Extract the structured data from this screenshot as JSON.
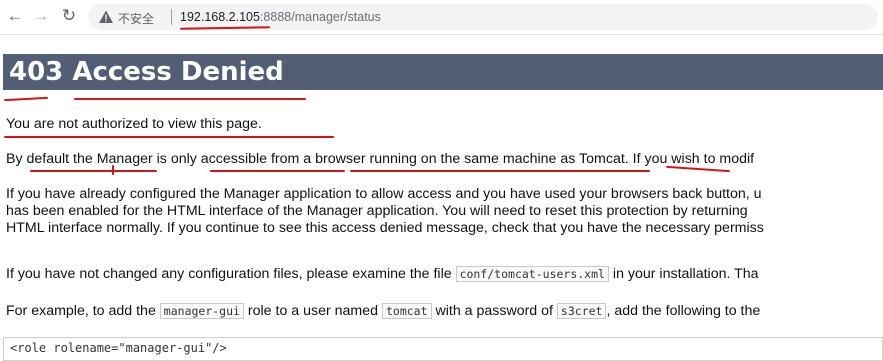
{
  "browser": {
    "security_label": "不安全",
    "url_host": "192.168.2.105",
    "url_rest": ":8888/manager/status"
  },
  "page": {
    "heading": "403 Access Denied",
    "p1": "You are not authorized to view this page.",
    "p2": "By default the Manager is only accessible from a browser running on the same machine as Tomcat. If you wish to modif",
    "p3_line1": "If you have already configured the Manager application to allow access and you have used your browsers back button, u",
    "p3_line2": "has been enabled for the HTML interface of the Manager application. You will need to reset this protection by returning",
    "p3_line3": "HTML interface normally. If you continue to see this access denied message, check that you have the necessary permiss",
    "p4_before": "If you have not changed any configuration files, please examine the file ",
    "p4_code": "conf/tomcat-users.xml",
    "p4_after": " in your installation. Tha",
    "p5_a": "For example, to add the ",
    "p5_code1": "manager-gui",
    "p5_b": " role to a user named ",
    "p5_code2": "tomcat",
    "p5_c": " with a password of ",
    "p5_code3": "s3cret",
    "p5_d": ", add the following to the",
    "code_line": "<role rolename=\"manager-gui\"/>"
  },
  "colors": {
    "banner": "#525d76",
    "annotation": "#d0161b"
  }
}
